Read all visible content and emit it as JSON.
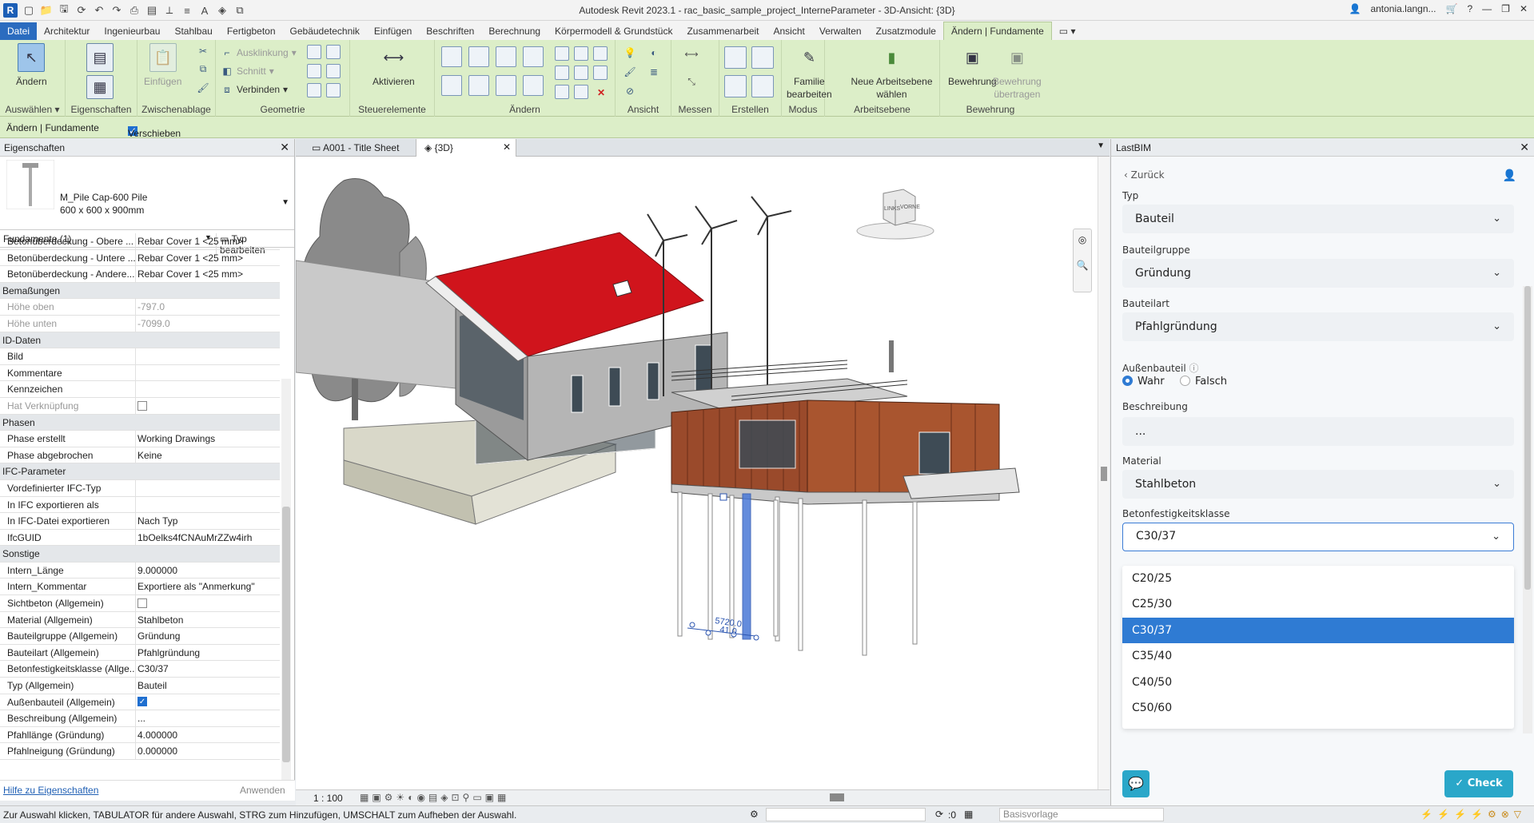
{
  "titlebar": {
    "title": "Autodesk Revit 2023.1 - rac_basic_sample_project_InterneParameter - 3D-Ansicht: {3D}",
    "user": "antonia.langn...",
    "app_letter": "R"
  },
  "tabs": [
    {
      "label": "Datei"
    },
    {
      "label": "Architektur"
    },
    {
      "label": "Ingenieurbau"
    },
    {
      "label": "Stahlbau"
    },
    {
      "label": "Fertigbeton"
    },
    {
      "label": "Gebäudetechnik"
    },
    {
      "label": "Einfügen"
    },
    {
      "label": "Beschriften"
    },
    {
      "label": "Berechnung"
    },
    {
      "label": "Körpermodell & Grundstück"
    },
    {
      "label": "Zusammenarbeit"
    },
    {
      "label": "Ansicht"
    },
    {
      "label": "Verwalten"
    },
    {
      "label": "Zusatzmodule"
    },
    {
      "label": "Ändern | Fundamente"
    }
  ],
  "ribbon": {
    "aendern": "Ändern",
    "einfuegen": "Einfügen",
    "ausklinkung": "Ausklinkung",
    "schnitt": "Schnitt",
    "verbinden": "Verbinden",
    "aktivieren": "Aktivieren",
    "familie": "Familie",
    "bearbeiten": "bearbeiten",
    "neue_ebene": "Neue Arbeitsebene wählen",
    "bewehrung": "Bewehrung",
    "bewehrung_uebertragen_1": "Bewehrung",
    "bewehrung_uebertragen_2": "übertragen",
    "panels": {
      "auswaehlen": "Auswählen",
      "eigenschaften": "Eigenschaften",
      "zwischenablage": "Zwischenablage",
      "geometrie": "Geometrie",
      "steuerelemente": "Steuerelemente",
      "aendern": "Ändern",
      "ansicht": "Ansicht",
      "messen": "Messen",
      "erstellen": "Erstellen",
      "modus": "Modus",
      "arbeitsebene": "Arbeitsebene",
      "bewehrung": "Bewehrung"
    }
  },
  "optbar": {
    "context": "Ändern | Fundamente",
    "raster_label": "Verschieben mit Raster"
  },
  "properties": {
    "title": "Eigenschaften",
    "type_name": "M_Pile Cap-600 Pile",
    "type_size": "600 x 600 x 900mm",
    "selector": "Fundamente (1)",
    "edit_type": "Typ bearbeiten",
    "rows": [
      {
        "k": "Betonüberdeckung - Obere ...",
        "v": "Rebar Cover 1 <25 mm>"
      },
      {
        "k": "Betonüberdeckung - Untere ...",
        "v": "Rebar Cover 1 <25 mm>"
      },
      {
        "k": "Betonüberdeckung - Andere...",
        "v": "Rebar Cover 1 <25 mm>"
      },
      {
        "section": "Bemaßungen"
      },
      {
        "k": "Höhe oben",
        "v": "-797.0",
        "grey": true
      },
      {
        "k": "Höhe unten",
        "v": "-7099.0",
        "grey": true
      },
      {
        "section": "ID-Daten"
      },
      {
        "k": "Bild",
        "v": ""
      },
      {
        "k": "Kommentare",
        "v": ""
      },
      {
        "k": "Kennzeichen",
        "v": ""
      },
      {
        "k": "Hat Verknüpfung",
        "v": "",
        "grey": true,
        "checkbox": "off"
      },
      {
        "section": "Phasen"
      },
      {
        "k": "Phase erstellt",
        "v": "Working Drawings"
      },
      {
        "k": "Phase abgebrochen",
        "v": "Keine"
      },
      {
        "section": "IFC-Parameter"
      },
      {
        "k": "Vordefinierter IFC-Typ",
        "v": ""
      },
      {
        "k": "In IFC exportieren als",
        "v": ""
      },
      {
        "k": "In IFC-Datei exportieren",
        "v": "Nach Typ"
      },
      {
        "k": "IfcGUID",
        "v": "1bOelks4fCNAuMrZZw4irh"
      },
      {
        "section": "Sonstige"
      },
      {
        "k": "Intern_Länge",
        "v": "9.000000"
      },
      {
        "k": "Intern_Kommentar",
        "v": "Exportiere als \"Anmerkung\""
      },
      {
        "k": "Sichtbeton (Allgemein)",
        "v": "",
        "checkbox": "off"
      },
      {
        "k": "Material (Allgemein)",
        "v": "Stahlbeton"
      },
      {
        "k": "Bauteilgruppe (Allgemein)",
        "v": "Gründung"
      },
      {
        "k": "Bauteilart (Allgemein)",
        "v": "Pfahlgründung"
      },
      {
        "k": "Betonfestigkeitsklasse (Allge...",
        "v": "C30/37"
      },
      {
        "k": "Typ (Allgemein)",
        "v": "Bauteil"
      },
      {
        "k": "Außenbauteil (Allgemein)",
        "v": "",
        "checkbox": "on"
      },
      {
        "k": "Beschreibung (Allgemein)",
        "v": "..."
      },
      {
        "k": "Pfahllänge (Gründung)",
        "v": "4.000000"
      },
      {
        "k": "Pfahlneigung (Gründung)",
        "v": "0.000000"
      }
    ],
    "help_link": "Hilfe zu Eigenschaften",
    "apply": "Anwenden"
  },
  "view": {
    "tabs": [
      {
        "label": "A001 - Title Sheet"
      },
      {
        "label": "{3D}"
      }
    ],
    "scale": "1 : 100",
    "viewcube_left": "LINKS",
    "viewcube_front": "VORNE",
    "dimension_text": "5720.0",
    "dimension_text2": "41.0"
  },
  "lastbim": {
    "title": "LastBIM",
    "back": "Zurück",
    "typ_label": "Typ",
    "typ_value": "Bauteil",
    "gruppe_label": "Bauteilgruppe",
    "gruppe_value": "Gründung",
    "art_label": "Bauteilart",
    "art_value": "Pfahlgründung",
    "aussen_label": "Außenbauteil",
    "wahr": "Wahr",
    "falsch": "Falsch",
    "beschreibung_label": "Beschreibung",
    "beschreibung_value": "...",
    "material_label": "Material",
    "material_value": "Stahlbeton",
    "klasse_label": "Betonfestigkeitsklasse",
    "klasse_value": "C30/37",
    "options": [
      "C20/25",
      "C25/30",
      "C30/37",
      "C35/40",
      "C40/50",
      "C50/60"
    ],
    "selected_option": "C30/37",
    "check": "Check"
  },
  "status": {
    "message": "Zur Auswahl klicken, TABULATOR für andere Auswahl, STRG zum Hinzufügen, UMSCHALT zum Aufheben der Auswahl.",
    "coord": ":0",
    "template": "Basisvorlage"
  },
  "colors": {
    "ribbon_bg": "#dceec8",
    "roof_red": "#d0141c",
    "cladding": "#9a4a2b",
    "accent": "#2f7bd3",
    "check": "#2aa7c9"
  }
}
